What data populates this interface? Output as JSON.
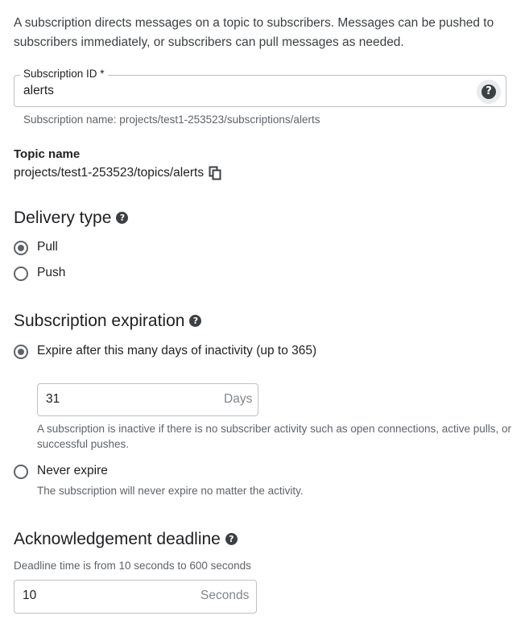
{
  "intro": "A subscription directs messages on a topic to subscribers. Messages can be pushed to subscribers immediately, or subscribers can pull messages as needed.",
  "subscription_id": {
    "label": "Subscription ID *",
    "value": "alerts",
    "hint": "Subscription name: projects/test1-253523/subscriptions/alerts",
    "help_icon": "help-circle-icon"
  },
  "topic": {
    "label": "Topic name",
    "path": "projects/test1-253523/topics/alerts",
    "copy_icon": "copy-icon"
  },
  "delivery": {
    "title": "Delivery type",
    "options": [
      {
        "label": "Pull",
        "selected": true
      },
      {
        "label": "Push",
        "selected": false
      }
    ]
  },
  "expiration": {
    "title": "Subscription expiration",
    "expire_option": "Expire after this many days of inactivity (up to 365)",
    "days_value": "31",
    "days_unit": "Days",
    "days_hint": "A subscription is inactive if there is no subscriber activity such as open connections, active pulls, or successful pushes.",
    "never_option": "Never expire",
    "never_hint": "The subscription will never expire no matter the activity."
  },
  "ack": {
    "title": "Acknowledgement deadline",
    "hint": "Deadline time is from 10 seconds to 600 seconds",
    "value": "10",
    "unit": "Seconds"
  }
}
